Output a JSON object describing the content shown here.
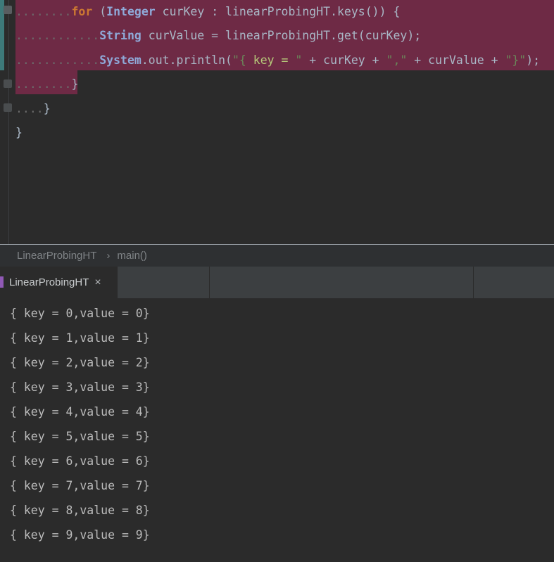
{
  "editor": {
    "lines": [
      {
        "indent": "........",
        "parts": [
          {
            "t": "for",
            "c": "kw"
          },
          {
            "t": " (",
            "c": "plain"
          },
          {
            "t": "Integer",
            "c": "cls"
          },
          {
            "t": " curKey : linearProbingHT.keys()) {",
            "c": "plain"
          }
        ]
      },
      {
        "indent": "............",
        "parts": [
          {
            "t": "String",
            "c": "cls"
          },
          {
            "t": " curValue = linearProbingHT.get(curKey);",
            "c": "plain"
          }
        ]
      },
      {
        "indent": "............",
        "parts": [
          {
            "t": "System",
            "c": "cls"
          },
          {
            "t": ".out.println(",
            "c": "plain"
          },
          {
            "t": "\"{ ",
            "c": "str"
          },
          {
            "t": "key = ",
            "c": "strk"
          },
          {
            "t": "\"",
            "c": "str"
          },
          {
            "t": " + curKey + ",
            "c": "plain"
          },
          {
            "t": "\",\"",
            "c": "str"
          },
          {
            "t": " + curValue + ",
            "c": "plain"
          },
          {
            "t": "\"}\"",
            "c": "str"
          },
          {
            "t": ");",
            "c": "plain"
          }
        ]
      },
      {
        "indent": "........",
        "parts": [
          {
            "t": "}",
            "c": "plain"
          }
        ]
      },
      {
        "indent": "....",
        "parts": [
          {
            "t": "}",
            "c": "plain"
          }
        ]
      },
      {
        "indent": "",
        "parts": [
          {
            "t": "}",
            "c": "plain"
          }
        ]
      }
    ]
  },
  "breadcrumb": {
    "items": [
      "LinearProbingHT",
      "main()"
    ],
    "separator": "›"
  },
  "tabs": [
    {
      "label": "LinearProbingHT",
      "close": "×",
      "active": true
    }
  ],
  "console": {
    "lines": [
      "{ key = 0,value = 0}",
      "{ key = 1,value = 1}",
      "{ key = 2,value = 2}",
      "{ key = 3,value = 3}",
      "{ key = 4,value = 4}",
      "{ key = 5,value = 5}",
      "{ key = 6,value = 6}",
      "{ key = 7,value = 7}",
      "{ key = 8,value = 8}",
      "{ key = 9,value = 9}"
    ]
  },
  "colors": {
    "selection": "#6e2a45",
    "background": "#2b2b2b",
    "keyword": "#cc7832",
    "string": "#6a8759"
  }
}
